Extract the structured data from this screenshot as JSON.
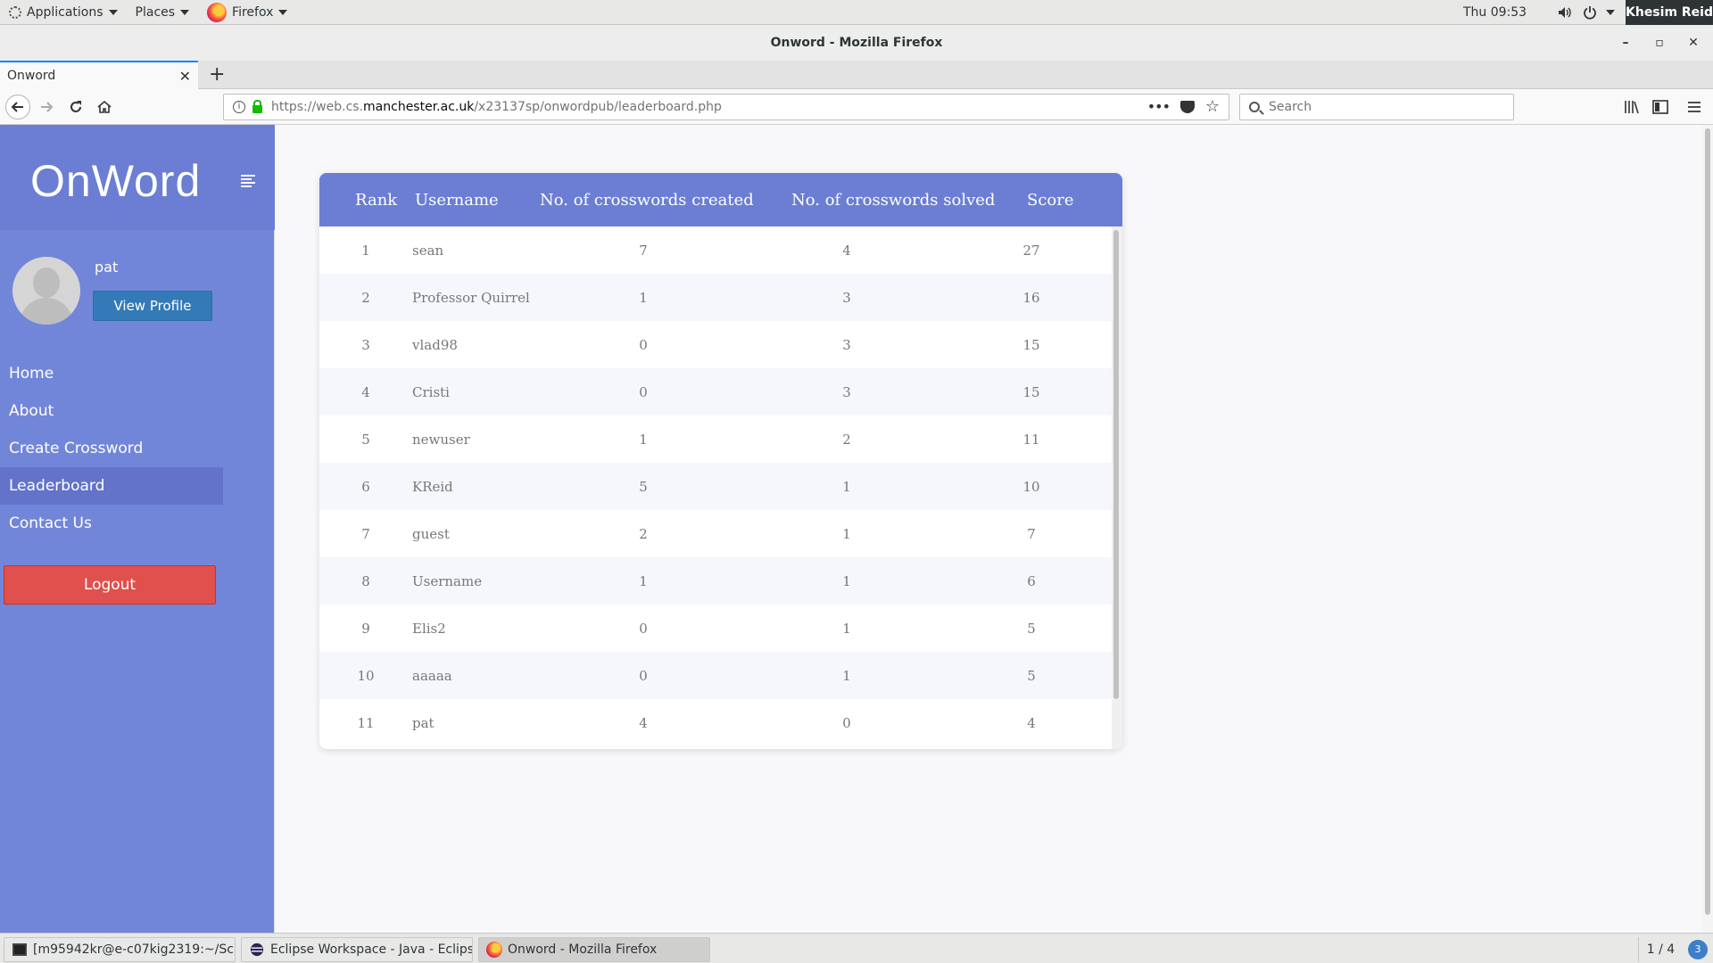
{
  "system": {
    "applications_label": "Applications",
    "places_label": "Places",
    "firefox_label": "Firefox",
    "clock": "Thu 09:53",
    "user": "Khesim Reid"
  },
  "browser": {
    "window_title": "Onword - Mozilla Firefox",
    "tab_title": "Onword",
    "url_prefix": "https://web.cs.",
    "url_domain": "manchester.ac.uk",
    "url_path": "/x23137sp/onwordpub/leaderboard.php",
    "search_placeholder": "Search"
  },
  "sidebar": {
    "brand": "OnWord",
    "username": "pat",
    "view_profile_label": "View Profile",
    "menu": [
      {
        "label": "Home"
      },
      {
        "label": "About"
      },
      {
        "label": "Create Crossword"
      },
      {
        "label": "Leaderboard",
        "active": true
      },
      {
        "label": "Contact Us"
      }
    ],
    "logout_label": "Logout"
  },
  "leaderboard": {
    "headers": {
      "rank": "Rank",
      "username": "Username",
      "created": "No. of crosswords created",
      "solved": "No. of crosswords solved",
      "score": "Score"
    },
    "rows": [
      {
        "rank": "1",
        "username": "sean",
        "created": "7",
        "solved": "4",
        "score": "27"
      },
      {
        "rank": "2",
        "username": "Professor Quirrel",
        "created": "1",
        "solved": "3",
        "score": "16"
      },
      {
        "rank": "3",
        "username": "vlad98",
        "created": "0",
        "solved": "3",
        "score": "15"
      },
      {
        "rank": "4",
        "username": "Cristi",
        "created": "0",
        "solved": "3",
        "score": "15"
      },
      {
        "rank": "5",
        "username": "newuser",
        "created": "1",
        "solved": "2",
        "score": "11"
      },
      {
        "rank": "6",
        "username": "KReid",
        "created": "5",
        "solved": "1",
        "score": "10"
      },
      {
        "rank": "7",
        "username": "guest",
        "created": "2",
        "solved": "1",
        "score": "7"
      },
      {
        "rank": "8",
        "username": "Username",
        "created": "1",
        "solved": "1",
        "score": "6"
      },
      {
        "rank": "9",
        "username": "Elis2",
        "created": "0",
        "solved": "1",
        "score": "5"
      },
      {
        "rank": "10",
        "username": "aaaaa",
        "created": "0",
        "solved": "1",
        "score": "5"
      },
      {
        "rank": "11",
        "username": "pat",
        "created": "4",
        "solved": "0",
        "score": "4"
      }
    ]
  },
  "taskbar": {
    "items": [
      {
        "label": "[m95942kr@e-c07kig2319:~/Sc...",
        "icon": "terminal-icon"
      },
      {
        "label": "Eclipse Workspace - Java - Eclipse",
        "icon": "eclipse-icon"
      },
      {
        "label": "Onword - Mozilla Firefox",
        "icon": "firefox-icon",
        "active": true
      }
    ],
    "workspace": "1 / 4",
    "notification_count": "3"
  },
  "colors": {
    "sidebar": "#7286d9",
    "header": "#6b7ed3",
    "view_profile": "#337ab7",
    "logout": "#e0504d"
  }
}
